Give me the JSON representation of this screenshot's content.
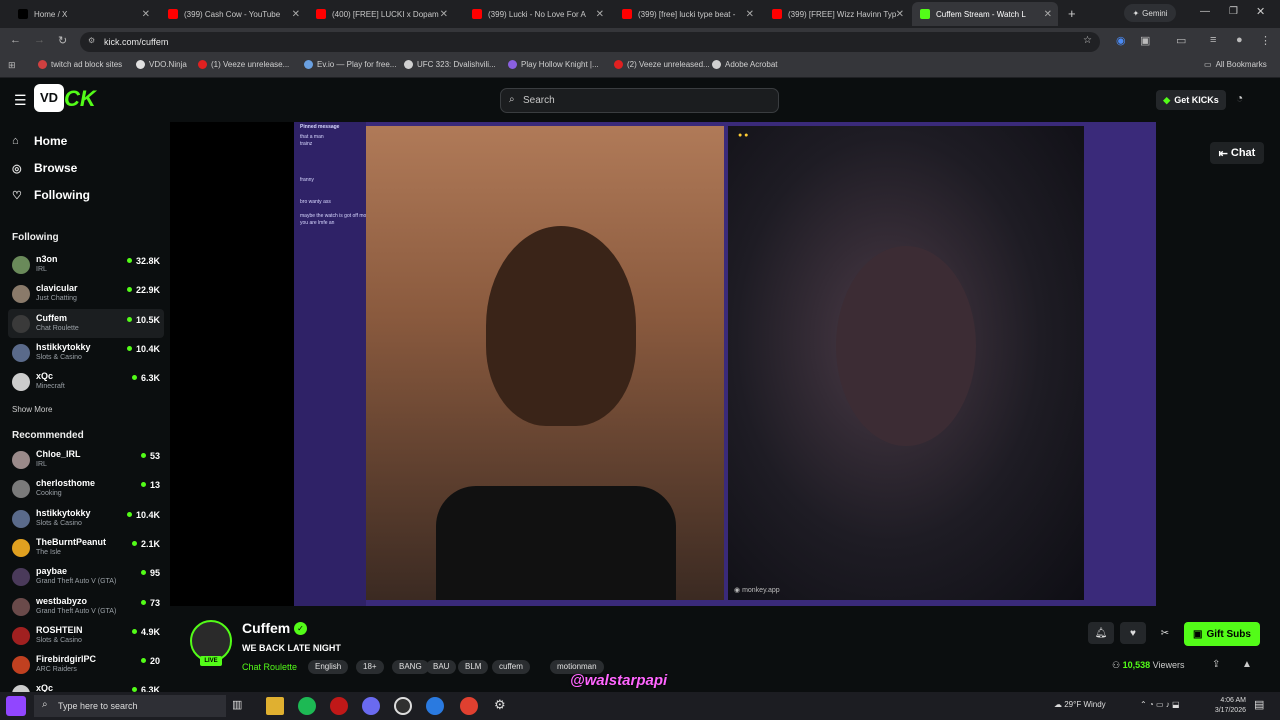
{
  "browser": {
    "tabs": [
      {
        "label": "Home / X",
        "color": "#000000"
      },
      {
        "label": "(399) Cash Cow - YouTube",
        "color": "#ff0000"
      },
      {
        "label": "(400) [FREE] LUCKI x Dopam",
        "color": "#ff0000"
      },
      {
        "label": "(399) Lucki - No Love For A",
        "color": "#ff0000"
      },
      {
        "label": "(399) [free] lucki type beat -",
        "color": "#ff0000"
      },
      {
        "label": "(399) [FREE] Wizz Havinn Typ",
        "color": "#ff0000"
      },
      {
        "label": "Cuffem Stream - Watch L",
        "color": "#53fc18"
      }
    ],
    "gemini_label": "Gemini",
    "url": "kick.com/cuffem",
    "bookmarks": [
      "twitch ad block sites",
      "VDO.Ninja",
      "(1) Veeze unrelease...",
      "Ev.io — Play for free...",
      "UFC 323: Dvalishvili...",
      "Play Hollow Knight |...",
      "(2) Veeze unreleased...",
      "Adobe Acrobat"
    ],
    "all_bookmarks": "All Bookmarks"
  },
  "kick": {
    "search_placeholder": "Search",
    "get_kicks": "Get KICKs",
    "nav": {
      "home": "Home",
      "browse": "Browse",
      "following": "Following"
    },
    "following_header": "Following",
    "following": [
      {
        "name": "n3on",
        "category": "IRL",
        "viewers": "32.8K",
        "color": "#6a8a5a"
      },
      {
        "name": "clavicular",
        "category": "Just Chatting",
        "viewers": "22.9K",
        "color": "#8a7a6a"
      },
      {
        "name": "Cuffem",
        "category": "Chat Roulette",
        "viewers": "10.5K",
        "color": "#3a3a3a"
      },
      {
        "name": "hstikkytokky",
        "category": "Slots & Casino",
        "viewers": "10.4K",
        "color": "#5a6a8a"
      },
      {
        "name": "xQc",
        "category": "Minecraft",
        "viewers": "6.3K",
        "color": "#cccccc"
      }
    ],
    "show_more": "Show More",
    "recommended_header": "Recommended",
    "recommended": [
      {
        "name": "Chloe_IRL",
        "category": "IRL",
        "viewers": "53",
        "color": "#9a8a8a"
      },
      {
        "name": "cherlosthome",
        "category": "Cooking",
        "viewers": "13",
        "color": "#7a7a7a"
      },
      {
        "name": "hstikkytokky",
        "category": "Slots & Casino",
        "viewers": "10.4K",
        "color": "#5a6a8a"
      },
      {
        "name": "TheBurntPeanut",
        "category": "The Isle",
        "viewers": "2.1K",
        "color": "#e0a020"
      },
      {
        "name": "paybae",
        "category": "Grand Theft Auto V (GTA)",
        "viewers": "95",
        "color": "#4a3a5a"
      },
      {
        "name": "westbabyzo",
        "category": "Grand Theft Auto V (GTA)",
        "viewers": "73",
        "color": "#6a4a4a"
      },
      {
        "name": "ROSHTEIN",
        "category": "Slots & Casino",
        "viewers": "4.9K",
        "color": "#a02020"
      },
      {
        "name": "FirebirdgirlPC",
        "category": "ARC Raiders",
        "viewers": "20",
        "color": "#c04020"
      },
      {
        "name": "xQc",
        "category": "",
        "viewers": "6.3K",
        "color": "#cccccc"
      }
    ],
    "chat_button": "Chat",
    "overlay": {
      "pinned": "Pinned message",
      "lines": [
        "that a man",
        "trainz",
        "",
        "",
        "",
        "",
        "franny",
        "",
        "",
        "bro wanty ass",
        "",
        "maybe the watch is got off monkey",
        "you are lmfe an",
        "",
        "",
        "",
        "",
        "",
        ""
      ],
      "remote_label": "monkey.app"
    },
    "stream": {
      "streamer": "Cuffem",
      "live": "LIVE",
      "title": "WE BACK LATE NIGHT",
      "category": "Chat Roulette",
      "tags": [
        "English",
        "18+",
        "BANG",
        "BAU",
        "BLM",
        "cuffem",
        "motionman"
      ],
      "gift_subs": "Gift Subs",
      "viewers_count": "10,538",
      "viewers_label": "Viewers"
    }
  },
  "watermark": "@walstarpapi",
  "taskbar": {
    "search_placeholder": "Type here to search",
    "weather": "29°F  Windy",
    "time": "4:06 AM",
    "date": "3/17/2026"
  },
  "colors": {
    "brand": "#53fc18",
    "background": "#0b0e0f",
    "stage": "#3a2a7a"
  }
}
